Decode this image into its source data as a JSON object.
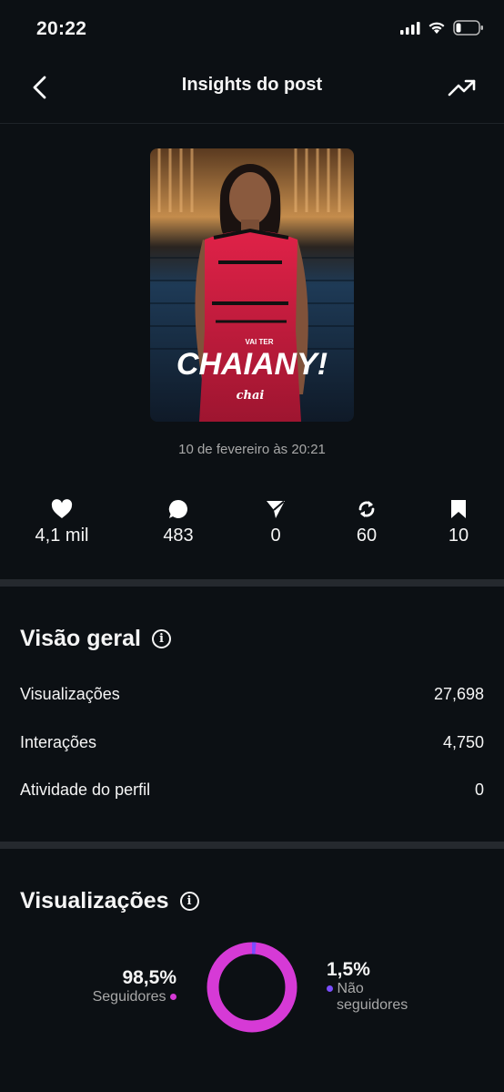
{
  "status_bar": {
    "time": "20:22"
  },
  "header": {
    "title": "Insights do post"
  },
  "post": {
    "thumbnail_text_small": "VAI TER",
    "thumbnail_text_big": "CHAIANY!",
    "thumbnail_logo": "chai",
    "date": "10 de fevereiro às 20:21"
  },
  "stats": [
    {
      "icon": "heart-icon",
      "value": "4,1 mil"
    },
    {
      "icon": "comment-icon",
      "value": "483"
    },
    {
      "icon": "share-icon",
      "value": "0"
    },
    {
      "icon": "repost-icon",
      "value": "60"
    },
    {
      "icon": "bookmark-icon",
      "value": "10"
    }
  ],
  "overview": {
    "title": "Visão geral",
    "rows": [
      {
        "label": "Visualizações",
        "value": "27,698"
      },
      {
        "label": "Interações",
        "value": "4,750"
      },
      {
        "label": "Atividade do perfil",
        "value": "0"
      }
    ]
  },
  "views": {
    "title": "Visualizações",
    "followers_pct": "98,5%",
    "followers_label": "Seguidores",
    "followers_fraction": 0.985,
    "non_followers_pct": "1,5%",
    "non_followers_label_1": "Não",
    "non_followers_label_2": "seguidores",
    "colors": {
      "followers": "#d63ad6",
      "non_followers": "#7b4dff"
    }
  },
  "colors": {
    "background": "#0c1014",
    "divider": "#25292e",
    "muted": "#a8a8a8"
  }
}
